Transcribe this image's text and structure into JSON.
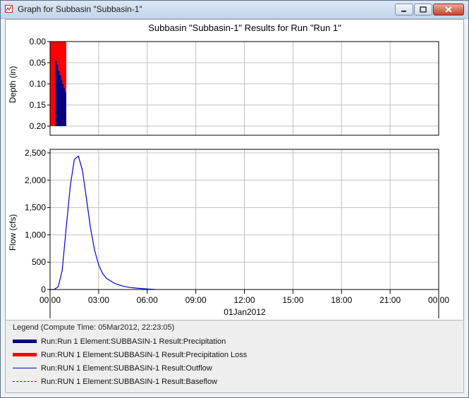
{
  "window": {
    "title": "Graph for Subbasin \"Subbasin-1\""
  },
  "chart_data": [
    {
      "type": "bar",
      "title": "Subbasin \"Subbasin-1\" Results for Run \"Run 1\"",
      "ylabel": "Depth (in)",
      "ylim": [
        0.0,
        0.2
      ],
      "y_inverted": true,
      "yticks": [
        "0.00",
        "0.05",
        "0.10",
        "0.15",
        "0.20"
      ],
      "x_unit": "hours",
      "xlim": [
        0,
        24
      ],
      "grid": true,
      "series": [
        {
          "name": "Run:RUN 1 Element:SUBBASIN-1 Result:Precipitation Loss",
          "color": "#ff0000",
          "x": [
            0.0,
            1.0
          ],
          "values": [
            0.2,
            0.2
          ]
        },
        {
          "name": "Run:Run 1 Element:SUBBASIN-1 Result:Precipitation",
          "color": "#000080",
          "x": [
            0.42,
            0.5,
            0.58,
            0.67,
            0.75,
            0.83,
            0.92,
            1.0
          ],
          "values": [
            0.045,
            0.055,
            0.07,
            0.08,
            0.09,
            0.1,
            0.11,
            0.12
          ]
        }
      ]
    },
    {
      "type": "line",
      "ylabel": "Flow (cfs)",
      "ylim": [
        0,
        2500
      ],
      "yticks": [
        "0",
        "500",
        "1,000",
        "1,500",
        "2,000",
        "2,500"
      ],
      "xticks": [
        "00:00",
        "03:00",
        "06:00",
        "09:00",
        "12:00",
        "15:00",
        "18:00",
        "21:00",
        "00:00"
      ],
      "xlabel": "01Jan2012",
      "x_unit": "hours",
      "xlim": [
        0,
        24
      ],
      "grid": true,
      "series": [
        {
          "name": "Run:RUN 1 Element:SUBBASIN-1 Result:Outflow",
          "color": "#0000dd",
          "x": [
            0,
            0.25,
            0.5,
            0.75,
            1.0,
            1.25,
            1.5,
            1.75,
            2.0,
            2.25,
            2.5,
            2.75,
            3.0,
            3.25,
            3.5,
            4.0,
            4.5,
            5.0,
            5.5,
            6.0,
            6.5
          ],
          "values": [
            0,
            0,
            50,
            350,
            1150,
            1900,
            2380,
            2440,
            2180,
            1650,
            1120,
            720,
            450,
            290,
            200,
            110,
            60,
            35,
            20,
            10,
            0
          ]
        },
        {
          "name": "Run:RUN 1 Element:SUBBASIN-1 Result:Baseflow",
          "color": "#990000",
          "x": [
            0,
            24
          ],
          "values": [
            0,
            0
          ]
        }
      ]
    }
  ],
  "legend": {
    "title": "Legend (Compute Time: 05Mar2012, 22:23:05)",
    "items": [
      "Run:Run 1 Element:SUBBASIN-1 Result:Precipitation",
      "Run:RUN 1 Element:SUBBASIN-1 Result:Precipitation Loss",
      "Run:RUN 1 Element:SUBBASIN-1 Result:Outflow",
      "Run:RUN 1 Element:SUBBASIN-1 Result:Baseflow"
    ],
    "colors": [
      "#000080",
      "#ff0000",
      "#0000dd",
      "#990000"
    ]
  }
}
